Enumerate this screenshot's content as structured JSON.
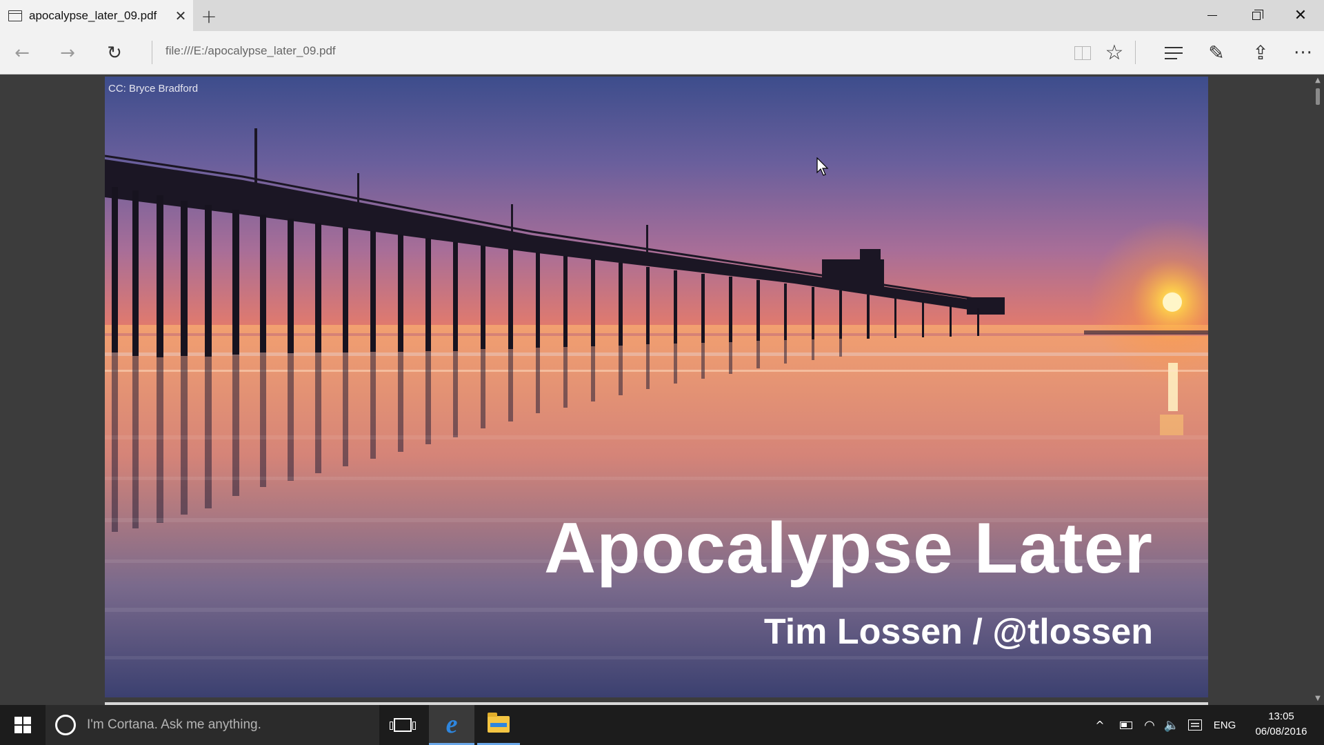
{
  "browser": {
    "tab": {
      "title": "apocalypse_later_09.pdf",
      "icon": "page-icon",
      "close": "✕"
    },
    "new_tab": "+",
    "window": {
      "minimize": "",
      "maximize": "",
      "close": "✕"
    },
    "nav": {
      "back": "←",
      "forward": "→",
      "refresh": "↻"
    },
    "address": "file:///E:/apocalypse_later_09.pdf",
    "tools": {
      "favorite": "☆",
      "web_note": "✎",
      "share": "⇪",
      "more": "···"
    }
  },
  "slide": {
    "credit": "CC: Bryce Bradford",
    "title": "Apocalypse Later",
    "subtitle": "Tim Lossen / @tlossen"
  },
  "taskbar": {
    "cortana_placeholder": "I'm Cortana. Ask me anything.",
    "tray": {
      "chevron": "^",
      "wifi": "◠",
      "volume": "🔈",
      "language": "ENG"
    },
    "clock": {
      "time": "13:05",
      "date": "06/08/2016"
    }
  },
  "colors": {
    "taskbar": "#1c1c1c",
    "cortana_box": "#2b2b2b",
    "edge_blue": "#2e86de",
    "accent": "#6aa7e8"
  }
}
